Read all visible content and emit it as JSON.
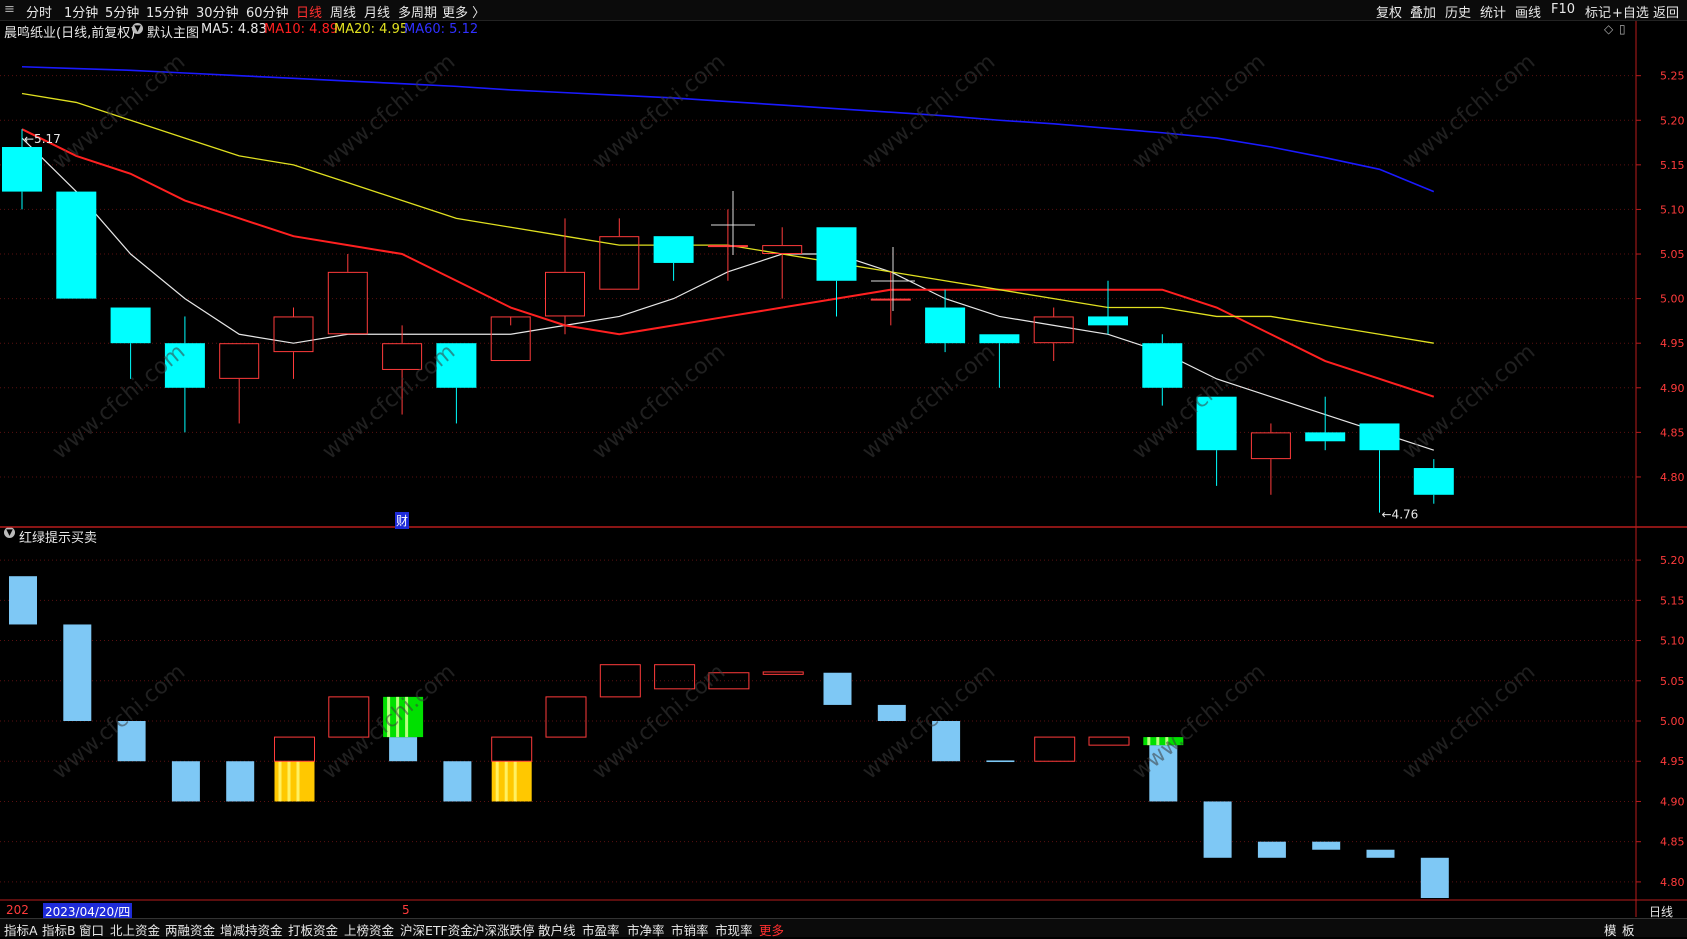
{
  "topbar": {
    "left_items": [
      "分时",
      "1分钟",
      "5分钟",
      "15分钟",
      "30分钟",
      "60分钟",
      "日线",
      "周线",
      "月线",
      "多周期",
      "更多 〉"
    ],
    "active_index": 6,
    "right_items": [
      "复权",
      "叠加",
      "历史",
      "统计",
      "画线",
      "F10",
      "标记",
      "+自选",
      "返回"
    ]
  },
  "infobar": {
    "stock": "晨鸣纸业(日线,前复权)",
    "main_chart": "默认主图",
    "ma5": "MA5: 4.83",
    "ma10": "MA10: 4.89",
    "ma20": "MA20: 4.95",
    "ma60": "MA60: 5.12"
  },
  "sub_title": "红绿提示买卖",
  "bottom_date": "2023/04/20/四",
  "bottom_left_prefix": "202",
  "bottom_marker": "5",
  "cai_label": "财",
  "right_bottom_label": "日线",
  "bottombar": {
    "items": [
      "指标A",
      "指标B",
      "窗口",
      "北上资金",
      "两融资金",
      "增减持资金",
      "打板资金",
      "上榜资金",
      "沪深ETF资金",
      "沪深涨跌停",
      "散户线",
      "市盈率",
      "市净率",
      "市销率",
      "市现率",
      "更多"
    ],
    "active_index": 15,
    "right_items": [
      "模",
      "板"
    ]
  },
  "colors": {
    "bg": "#000000",
    "up": "#ff3b3b",
    "down": "#00ffff",
    "ma5": "#e6e6e6",
    "ma10": "#ff2020",
    "ma20": "#e0e020",
    "ma60": "#1a1aff",
    "axis": "#b81c1c",
    "sub_down": "#7ec8f5"
  },
  "chart_data": [
    {
      "type": "candlestick",
      "title": "晨鸣纸业(日线,前复权)",
      "y_ticks": [
        4.8,
        4.85,
        4.9,
        4.95,
        5.0,
        5.05,
        5.1,
        5.15,
        5.2,
        5.25
      ],
      "ylim": [
        4.745,
        5.29
      ],
      "annotations": [
        {
          "text": "5.17",
          "x_index": 0
        },
        {
          "text": "4.76",
          "x_index": 25
        }
      ],
      "candles": [
        {
          "o": 5.17,
          "h": 5.19,
          "l": 5.1,
          "c": 5.12
        },
        {
          "o": 5.12,
          "h": 5.12,
          "l": 5.0,
          "c": 5.0
        },
        {
          "o": 4.99,
          "h": 4.99,
          "l": 4.91,
          "c": 4.95
        },
        {
          "o": 4.95,
          "h": 4.98,
          "l": 4.85,
          "c": 4.9
        },
        {
          "o": 4.91,
          "h": 4.95,
          "l": 4.86,
          "c": 4.95
        },
        {
          "o": 4.94,
          "h": 4.99,
          "l": 4.91,
          "c": 4.98
        },
        {
          "o": 4.96,
          "h": 5.05,
          "l": 4.96,
          "c": 5.03
        },
        {
          "o": 4.92,
          "h": 4.97,
          "l": 4.87,
          "c": 4.95
        },
        {
          "o": 4.95,
          "h": 4.95,
          "l": 4.86,
          "c": 4.9
        },
        {
          "o": 4.93,
          "h": 4.97,
          "l": 4.93,
          "c": 4.98
        },
        {
          "o": 4.98,
          "h": 5.09,
          "l": 4.96,
          "c": 5.03
        },
        {
          "o": 5.01,
          "h": 5.09,
          "l": 5.01,
          "c": 5.07
        },
        {
          "o": 5.07,
          "h": 5.07,
          "l": 5.02,
          "c": 5.04
        },
        {
          "o": 5.06,
          "h": 5.1,
          "l": 5.02,
          "c": 5.06
        },
        {
          "o": 5.05,
          "h": 5.08,
          "l": 5.0,
          "c": 5.06
        },
        {
          "o": 5.08,
          "h": 5.08,
          "l": 4.98,
          "c": 5.02
        },
        {
          "o": 5.0,
          "h": 5.03,
          "l": 4.97,
          "c": 5.0
        },
        {
          "o": 4.99,
          "h": 5.01,
          "l": 4.94,
          "c": 4.95
        },
        {
          "o": 4.96,
          "h": 4.96,
          "l": 4.9,
          "c": 4.95
        },
        {
          "o": 4.95,
          "h": 4.99,
          "l": 4.93,
          "c": 4.98
        },
        {
          "o": 4.98,
          "h": 5.02,
          "l": 4.96,
          "c": 4.97
        },
        {
          "o": 4.95,
          "h": 4.96,
          "l": 4.88,
          "c": 4.9
        },
        {
          "o": 4.89,
          "h": 4.89,
          "l": 4.79,
          "c": 4.83
        },
        {
          "o": 4.82,
          "h": 4.86,
          "l": 4.78,
          "c": 4.85
        },
        {
          "o": 4.85,
          "h": 4.89,
          "l": 4.83,
          "c": 4.84
        },
        {
          "o": 4.86,
          "h": 4.86,
          "l": 4.76,
          "c": 4.83
        },
        {
          "o": 4.81,
          "h": 4.82,
          "l": 4.77,
          "c": 4.78
        }
      ],
      "series": [
        {
          "name": "MA5",
          "values": [
            5.18,
            5.12,
            5.05,
            5.0,
            4.96,
            4.95,
            4.96,
            4.96,
            4.96,
            4.96,
            4.97,
            4.98,
            5.0,
            5.03,
            5.05,
            5.05,
            5.03,
            5.0,
            4.98,
            4.97,
            4.96,
            4.94,
            4.91,
            4.89,
            4.87,
            4.85,
            4.83
          ]
        },
        {
          "name": "MA10",
          "values": [
            5.19,
            5.16,
            5.14,
            5.11,
            5.09,
            5.07,
            5.06,
            5.05,
            5.02,
            4.99,
            4.97,
            4.96,
            4.97,
            4.98,
            4.99,
            5.0,
            5.01,
            5.01,
            5.01,
            5.01,
            5.01,
            5.01,
            4.99,
            4.96,
            4.93,
            4.91,
            4.89
          ]
        },
        {
          "name": "MA20",
          "values": [
            5.23,
            5.22,
            5.2,
            5.18,
            5.16,
            5.15,
            5.13,
            5.11,
            5.09,
            5.08,
            5.07,
            5.06,
            5.06,
            5.06,
            5.05,
            5.04,
            5.03,
            5.02,
            5.01,
            5.0,
            4.99,
            4.99,
            4.98,
            4.98,
            4.97,
            4.96,
            4.95
          ]
        },
        {
          "name": "MA60",
          "values": [
            5.26,
            5.258,
            5.256,
            5.253,
            5.25,
            5.247,
            5.244,
            5.241,
            5.238,
            5.234,
            5.231,
            5.228,
            5.225,
            5.221,
            5.217,
            5.213,
            5.209,
            5.205,
            5.2,
            5.196,
            5.191,
            5.186,
            5.18,
            5.17,
            5.158,
            5.145,
            5.12
          ]
        }
      ]
    },
    {
      "type": "bar",
      "title": "红绿提示买卖",
      "y_ticks": [
        4.8,
        4.85,
        4.9,
        4.95,
        5.0,
        5.05,
        5.1,
        5.15,
        5.2
      ],
      "ylim": [
        4.78,
        5.225
      ],
      "bars": [
        {
          "lo": 5.12,
          "hi": 5.18,
          "style": "blue"
        },
        {
          "lo": 5.0,
          "hi": 5.12,
          "style": "blue"
        },
        {
          "lo": 4.95,
          "hi": 5.0,
          "style": "blue"
        },
        {
          "lo": 4.9,
          "hi": 4.95,
          "style": "blue"
        },
        {
          "lo": 4.9,
          "hi": 4.95,
          "style": "blue"
        },
        {
          "lo": 4.9,
          "hi": 4.95,
          "style": "yellow",
          "cap_lo": 4.95,
          "cap_hi": 4.98
        },
        {
          "lo": 4.98,
          "hi": 5.03,
          "style": "redhollow"
        },
        {
          "lo": 4.95,
          "hi": 4.98,
          "style": "blue",
          "top_lo": 4.98,
          "top_hi": 5.03,
          "top_style": "green"
        },
        {
          "lo": 4.9,
          "hi": 4.95,
          "style": "blue"
        },
        {
          "lo": 4.9,
          "hi": 4.95,
          "style": "yellow",
          "cap_lo": 4.95,
          "cap_hi": 4.98
        },
        {
          "lo": 4.98,
          "hi": 5.03,
          "style": "redhollow"
        },
        {
          "lo": 5.03,
          "hi": 5.07,
          "style": "redhollow"
        },
        {
          "lo": 5.04,
          "hi": 5.07,
          "style": "redhollow"
        },
        {
          "lo": 5.04,
          "hi": 5.06,
          "style": "redhollow"
        },
        {
          "lo": 5.058,
          "hi": 5.061,
          "style": "redhollow"
        },
        {
          "lo": 5.02,
          "hi": 5.06,
          "style": "blue"
        },
        {
          "lo": 5.0,
          "hi": 5.02,
          "style": "blue"
        },
        {
          "lo": 4.95,
          "hi": 5.0,
          "style": "blue"
        },
        {
          "lo": 4.949,
          "hi": 4.951,
          "style": "blue"
        },
        {
          "lo": 4.95,
          "hi": 4.98,
          "style": "redhollow"
        },
        {
          "lo": 4.97,
          "hi": 4.98,
          "style": "redhollow"
        },
        {
          "lo": 4.9,
          "hi": 4.97,
          "style": "blue",
          "top_lo": 4.97,
          "top_hi": 4.98,
          "top_style": "green"
        },
        {
          "lo": 4.83,
          "hi": 4.9,
          "style": "blue"
        },
        {
          "lo": 4.83,
          "hi": 4.85,
          "style": "blue"
        },
        {
          "lo": 4.84,
          "hi": 4.85,
          "style": "blue"
        },
        {
          "lo": 4.83,
          "hi": 4.84,
          "style": "blue"
        },
        {
          "lo": 4.78,
          "hi": 4.83,
          "style": "blue"
        }
      ]
    }
  ]
}
